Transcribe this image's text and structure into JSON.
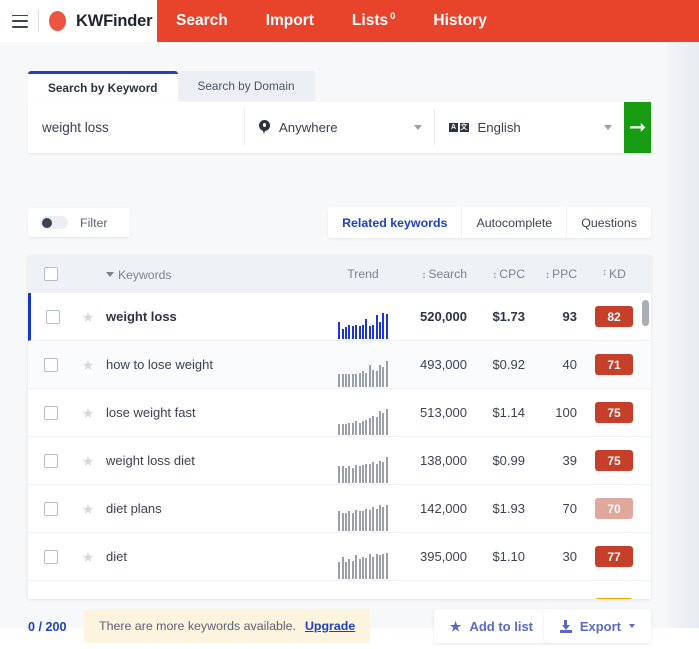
{
  "topbar": {
    "menu_icon": "hamburger-icon",
    "logo_icon": "kwfinder-logo-icon",
    "brand": "KWFinder",
    "brand_color": "#e8442c",
    "nav": [
      {
        "label": "Search",
        "badge": "",
        "active": true
      },
      {
        "label": "Import",
        "badge": "",
        "active": false
      },
      {
        "label": "Lists",
        "badge": "0",
        "active": false
      },
      {
        "label": "History",
        "badge": "",
        "active": false
      }
    ]
  },
  "search": {
    "tabs": [
      {
        "label": "Search by Keyword",
        "active": true
      },
      {
        "label": "Search by Domain",
        "active": false
      }
    ],
    "keyword_value": "weight loss",
    "keyword_placeholder": "Enter keyword",
    "location_icon": "location-pin-icon",
    "location_value": "Anywhere",
    "language_icon": "translate-icon",
    "language_value": "English",
    "submit_icon": "arrow-right-icon",
    "submit_color": "#179c11"
  },
  "controls": {
    "filter_label": "Filter",
    "filter_toggle_on": false,
    "result_tabs": [
      {
        "label": "Related keywords",
        "active": true
      },
      {
        "label": "Autocomplete",
        "active": false
      },
      {
        "label": "Questions",
        "active": false
      }
    ],
    "active_tab_color": "#1d41c4"
  },
  "table": {
    "headers": {
      "select_all": "select-all-checkbox",
      "keywords": "Keywords",
      "trend": "Trend",
      "search": "Search",
      "cpc": "CPC",
      "ppc": "PPC",
      "kd": "KD"
    },
    "rows": [
      {
        "keyword": "weight loss",
        "search": "520,000",
        "cpc": "$1.73",
        "ppc": "93",
        "kd": "82",
        "kd_color": "#c5402b",
        "selected": true,
        "trend_color": "#1d36d8",
        "trend": [
          11,
          6,
          7,
          9,
          8,
          9,
          8,
          9,
          13,
          8,
          9,
          16,
          11,
          18,
          17
        ]
      },
      {
        "keyword": "how to lose weight",
        "search": "493,000",
        "cpc": "$0.92",
        "ppc": "40",
        "kd": "71",
        "kd_color": "#c5402b",
        "selected": false,
        "trend_color": "#9ba0a8",
        "trend": [
          7,
          7,
          7,
          7,
          7,
          7,
          8,
          9,
          8,
          13,
          10,
          9,
          13,
          12,
          16
        ]
      },
      {
        "keyword": "lose weight fast",
        "search": "513,000",
        "cpc": "$1.14",
        "ppc": "100",
        "kd": "75",
        "kd_color": "#c5402b",
        "selected": false,
        "trend_color": "#9ba0a8",
        "trend": [
          6,
          6,
          6,
          7,
          7,
          8,
          7,
          8,
          9,
          10,
          12,
          11,
          15,
          14,
          17
        ]
      },
      {
        "keyword": "weight loss diet",
        "search": "138,000",
        "cpc": "$0.99",
        "ppc": "39",
        "kd": "75",
        "kd_color": "#c5402b",
        "selected": false,
        "trend_color": "#9ba0a8",
        "trend": [
          10,
          10,
          9,
          10,
          9,
          11,
          10,
          11,
          12,
          12,
          13,
          12,
          14,
          13,
          17
        ]
      },
      {
        "keyword": "diet plans",
        "search": "142,000",
        "cpc": "$1.93",
        "ppc": "70",
        "kd": "70",
        "kd_color": "#e0a79c",
        "selected": false,
        "trend_color": "#9ba0a8",
        "trend": [
          13,
          12,
          12,
          13,
          12,
          14,
          13,
          13,
          15,
          14,
          16,
          15,
          18,
          16,
          18
        ]
      },
      {
        "keyword": "diet",
        "search": "395,000",
        "cpc": "$1.10",
        "ppc": "30",
        "kd": "77",
        "kd_color": "#c5402b",
        "selected": false,
        "trend_color": "#9ba0a8",
        "trend": [
          11,
          15,
          11,
          13,
          12,
          16,
          13,
          15,
          14,
          17,
          15,
          17,
          16,
          17,
          18
        ]
      }
    ],
    "partial_row": {
      "kd_color": "#f0a500"
    },
    "scrollbar_color": "#a9adb4"
  },
  "footer": {
    "quota": "0 / 200",
    "notice_text": "There are more keywords available.",
    "upgrade_label": "Upgrade",
    "add_to_list": {
      "icon": "star-icon",
      "label": "Add to list"
    },
    "export": {
      "icon": "download-icon",
      "label": "Export",
      "caret": "chevron-down-icon"
    },
    "button_color": "#5a6ac4"
  }
}
